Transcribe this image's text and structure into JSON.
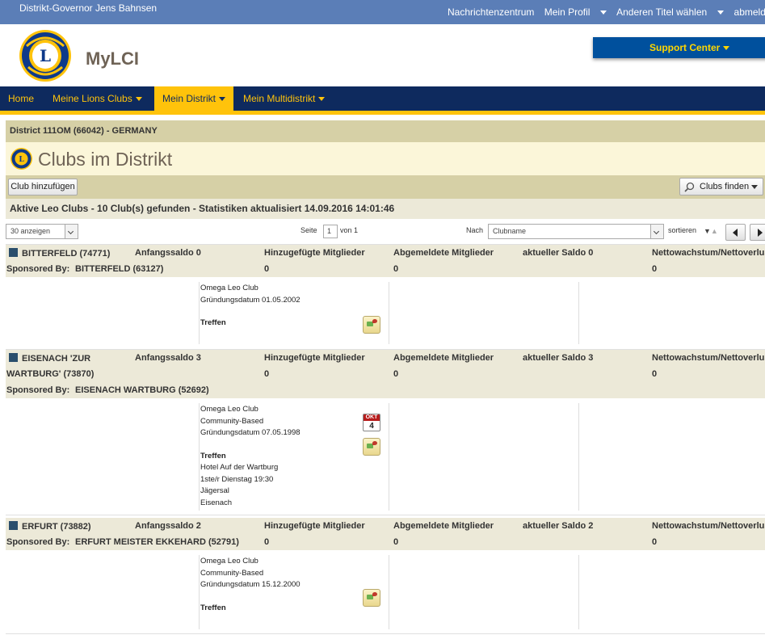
{
  "topbar": {
    "user": "Distrikt-Governor Jens Bahnsen",
    "links": [
      "Nachrichtenzentrum",
      "Mein Profil",
      "Anderen Titel wählen",
      "abmelden"
    ]
  },
  "header": {
    "brand": "MyLCI",
    "support": "Support Center"
  },
  "nav": {
    "items": [
      "Home",
      "Meine Lions Clubs",
      "Mein Distrikt",
      "Mein Multidistrikt"
    ],
    "active": "Mein Distrikt"
  },
  "district": "District 111OM (66042) - GERMANY",
  "page_title": "Clubs im Distrikt",
  "toolbar": {
    "add_club": "Club hinzufügen",
    "find_clubs": "Clubs finden"
  },
  "status": "Aktive Leo Clubs - 10 Club(s) gefunden - Statistiken aktualisiert 14.09.2016 14:01:46",
  "pager": {
    "show": "30 anzeigen",
    "page_label": "Seite",
    "page": "1",
    "of_label": "von 1",
    "sort_by_label": "Nach",
    "sort_field": "Clubname",
    "sort_label": "sortieren"
  },
  "column_headers": {
    "added": "Hinzugefügte Mitglieder",
    "removed": "Abgemeldete Mitglieder",
    "net": "Nettowachstum/Nettoverlust"
  },
  "clubs": [
    {
      "name": "BITTERFELD  (74771)",
      "start_balance": "Anfangssaldo 0",
      "current_balance": "aktueller Saldo 0",
      "added": "0",
      "removed": "0",
      "net": "0",
      "sponsored_label": "Sponsored By:",
      "sponsored_by": "BITTERFELD (63127)",
      "info": [
        "Omega Leo Club",
        "Gründungsdatum 01.05.2002"
      ],
      "meeting_label": "Treffen",
      "meeting": []
    },
    {
      "name": "EISENACH 'ZUR",
      "name_cont": "WARTBURG'  (73870)",
      "start_balance": "Anfangssaldo 3",
      "current_balance": "aktueller Saldo 3",
      "added": "0",
      "removed": "0",
      "net": "0",
      "sponsored_label": "Sponsored By:",
      "sponsored_by": "EISENACH WARTBURG (52692)",
      "info": [
        "Omega Leo Club",
        "Community-Based",
        "Gründungsdatum 07.05.1998"
      ],
      "meeting_label": "Treffen",
      "meeting": [
        "Hotel Auf der Wartburg",
        "1ste/r Dienstag 19:30",
        "Jägersal",
        "Eisenach"
      ],
      "calendar": {
        "month": "OKT",
        "day": "4"
      }
    },
    {
      "name": "ERFURT  (73882)",
      "start_balance": "Anfangssaldo 2",
      "current_balance": "aktueller Saldo 2",
      "added": "0",
      "removed": "0",
      "net": "0",
      "sponsored_label": "Sponsored By:",
      "sponsored_by": "ERFURT MEISTER EKKEHARD (52791)",
      "info": [
        "Omega Leo Club",
        "Community-Based",
        "Gründungsdatum 15.12.2000"
      ],
      "meeting_label": "Treffen",
      "meeting": []
    }
  ],
  "icons": {
    "lions_logo": "lions-logo",
    "search": "magnifier-icon",
    "map": "map-icon",
    "calendar": "calendar-icon"
  }
}
